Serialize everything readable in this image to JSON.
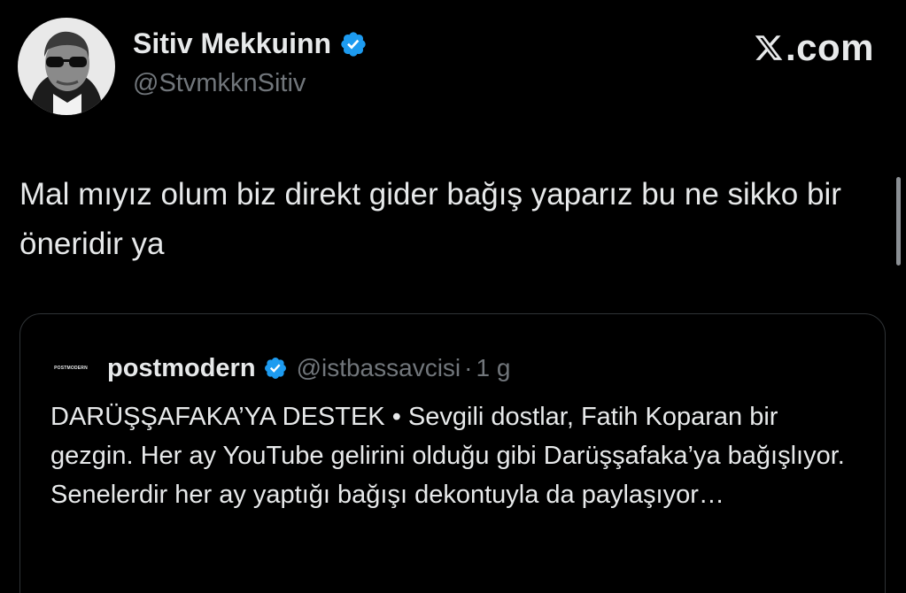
{
  "brand": {
    "label": ".com"
  },
  "author": {
    "display_name": "Sitiv Mekkuinn",
    "handle": "@StvmkknSitiv",
    "verified": true
  },
  "tweet": {
    "text": "Mal mıyız olum biz direkt gider bağış yaparız bu ne sikko bir öneridir ya"
  },
  "quoted_tweet": {
    "avatar_text": "POSTMODERN",
    "display_name": "postmodern",
    "verified": true,
    "handle": "@istbassavcisi",
    "separator": "·",
    "time": "1 g",
    "text": "DARÜŞŞAFAKA’YA DESTEK • Sevgili dostlar, Fatih Koparan bir gezgin. Her ay YouTube gelirini olduğu gibi Darüşşafaka’ya bağışlıyor. Senelerdir her ay yaptığı bağışı dekontuyla da paylaşıyor…"
  },
  "colors": {
    "background": "#000000",
    "text_primary": "#e7e9ea",
    "text_secondary": "#71767b",
    "verified_blue": "#1d9bf0",
    "card_border": "#2f3336"
  },
  "icons": {
    "verified": "verified-badge-icon",
    "brand": "x-logo-icon"
  }
}
